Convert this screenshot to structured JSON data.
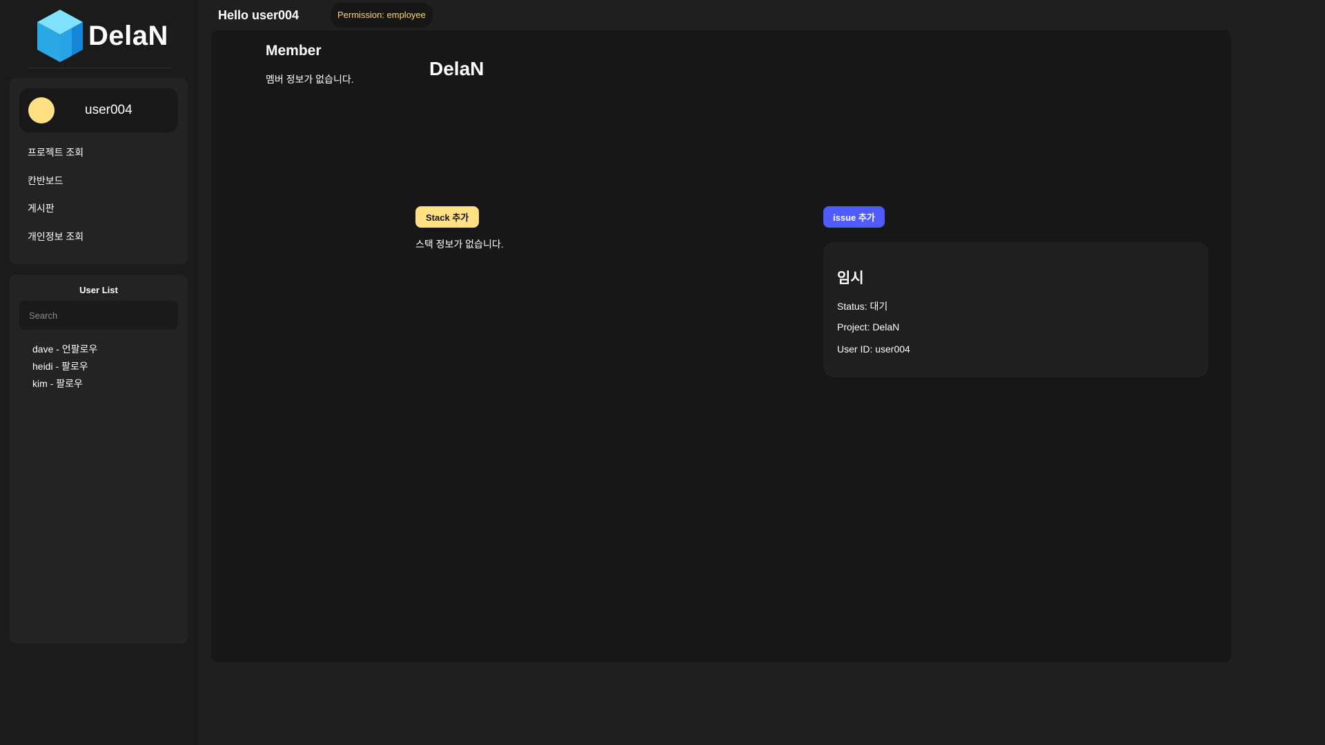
{
  "sidebar": {
    "logo_text": "DelaN",
    "profile": {
      "username": "user004"
    },
    "nav_items": [
      {
        "label": "프로젝트 조회"
      },
      {
        "label": "칸반보드"
      },
      {
        "label": "게시판"
      },
      {
        "label": "개인정보 조회"
      }
    ],
    "user_list": {
      "title": "User List",
      "search_placeholder": "Search",
      "users": [
        {
          "label": "dave - 언팔로우"
        },
        {
          "label": "heidi - 팔로우"
        },
        {
          "label": "kim - 팔로우"
        }
      ]
    }
  },
  "header": {
    "greeting": "Hello user004",
    "permission": "Permission: employee"
  },
  "main": {
    "member": {
      "title": "Member",
      "empty_text": "멤버 정보가 없습니다."
    },
    "project_title": "DelaN",
    "stack": {
      "button_label": "Stack 추가",
      "empty_text": "스택 정보가 없습니다."
    },
    "issue": {
      "button_label": "issue 추가",
      "card": {
        "title": "임시",
        "status": "Status: 대기",
        "project": "Project: DelaN",
        "user_id": "User ID: user004"
      }
    }
  },
  "colors": {
    "accent_yellow": "#ffe082",
    "accent_blue": "#4f5bff",
    "permission_text": "#ffd966",
    "logo_cube": "#3ec7f5"
  },
  "icons": {
    "logo": "cube-logo-icon",
    "avatar": "avatar-circle"
  }
}
